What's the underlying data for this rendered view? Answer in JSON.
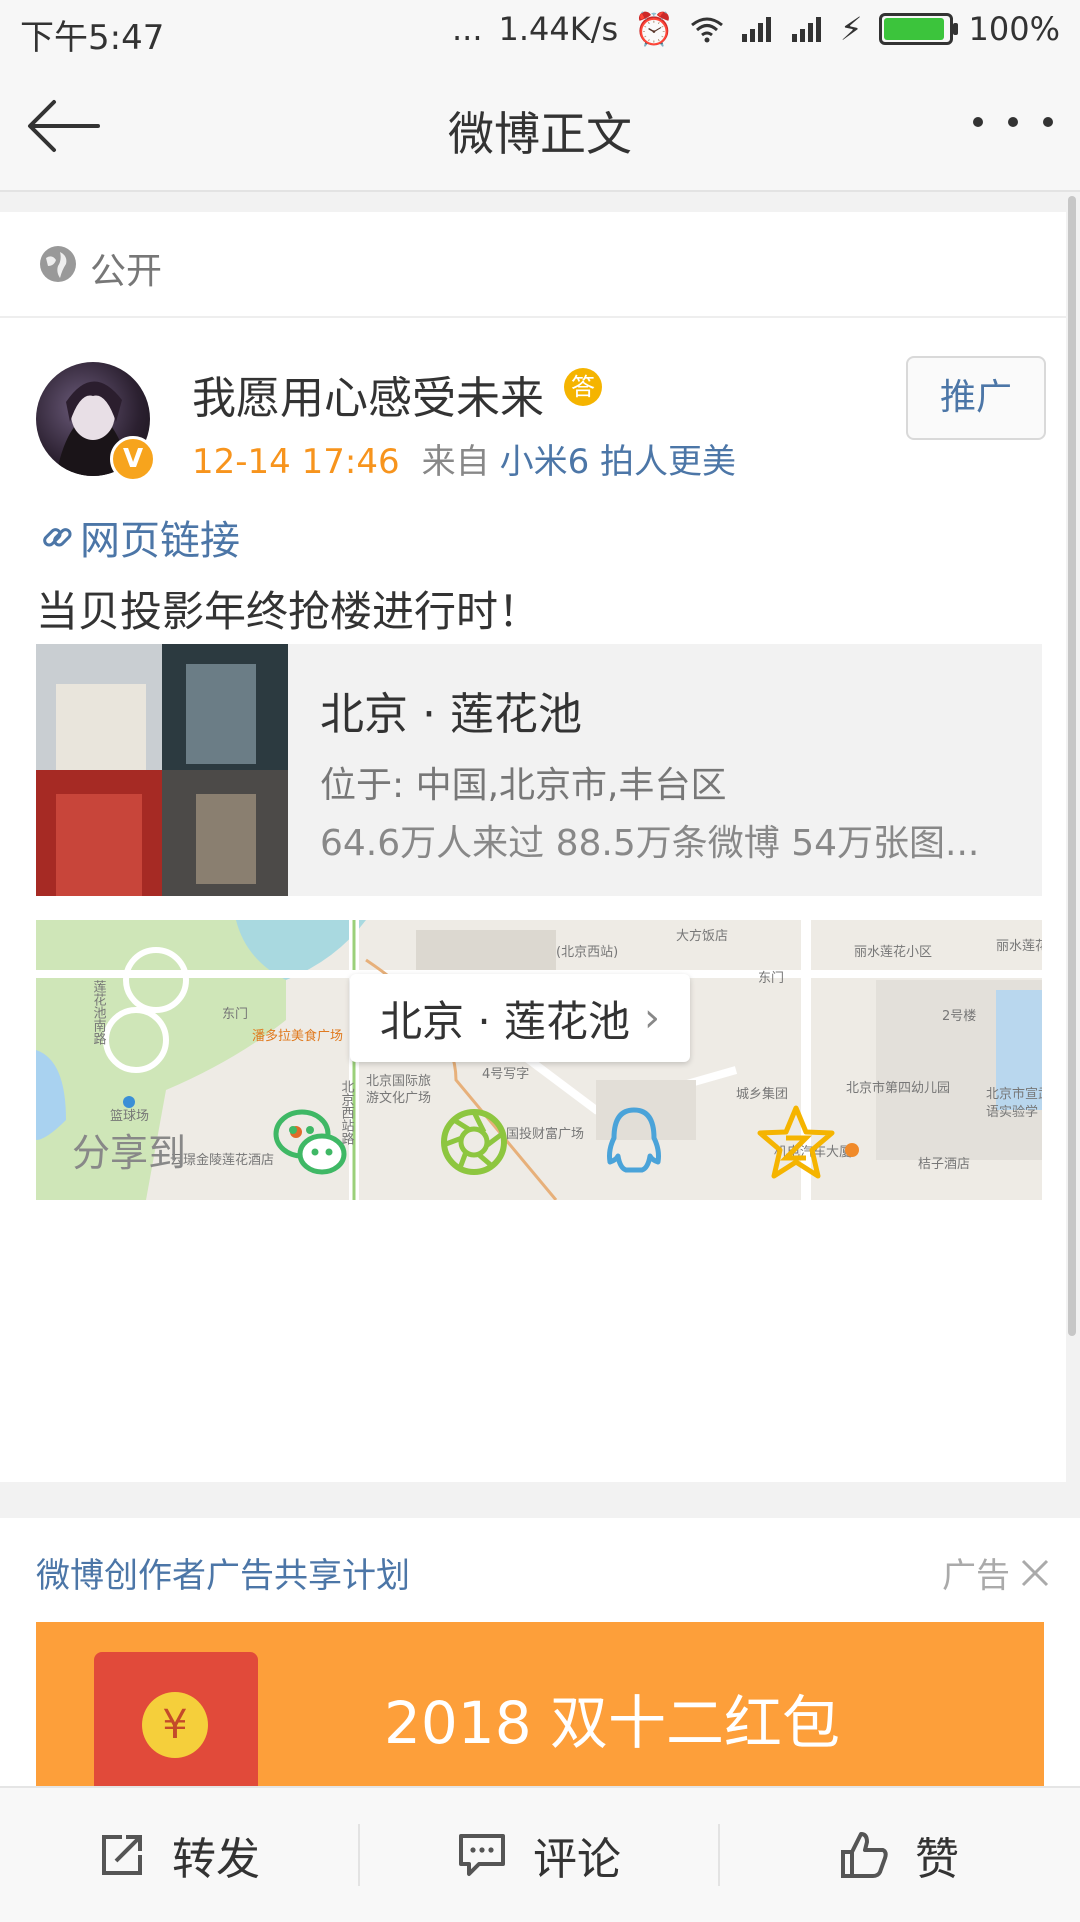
{
  "statusbar": {
    "time": "下午5:47",
    "dots": "...",
    "speed": "1.44K/s",
    "battery_pct": "100%",
    "battery_level": 1.0
  },
  "nav": {
    "title": "微博正文"
  },
  "post": {
    "visibility": "公开",
    "username": "我愿用心感受未来",
    "medal": "答",
    "vbadge": "V",
    "time": "12-14 17:46",
    "from_label": "来自",
    "device": "小米6 拍人更美",
    "promote_label": "推广",
    "link_label": "网页链接",
    "text": "当贝投影年终抢楼进行时！",
    "poi": {
      "title": "北京 · 莲花池",
      "address": "位于: 中国,北京市,丰台区",
      "stats": "64.6万人来过 88.5万条微博 54万张图..."
    },
    "map": {
      "label": "北京 · 莲花池",
      "places": [
        "大方饭店",
        "丽水莲花小区",
        "北京国际旅游文化广场",
        "潘多拉美食广场",
        "国投财富广场",
        "北京市第四幼儿园",
        "城乡集团",
        "机电汽车大厦",
        "桔子酒店",
        "云璟金陵莲花酒店",
        "篮球场",
        "莲花池南路",
        "北京西站路",
        "东门",
        "2号楼",
        "北京市宣武区语实验学",
        "4号写字",
        "(北京西站)",
        "丽水莲花河湖"
      ]
    }
  },
  "share": {
    "label": "分享到",
    "targets": [
      "wechat",
      "moments",
      "qq",
      "qzone"
    ]
  },
  "ad": {
    "plan": "微博创作者广告共享计划",
    "tag": "广告",
    "banner_title": "2018 双十二红包",
    "coin": "¥"
  },
  "bottom": {
    "repost": "转发",
    "comment": "评论",
    "like": "赞"
  },
  "colors": {
    "accent_blue": "#4c76a7",
    "time_orange": "#f7941d",
    "banner_orange": "#fd9f3a"
  }
}
